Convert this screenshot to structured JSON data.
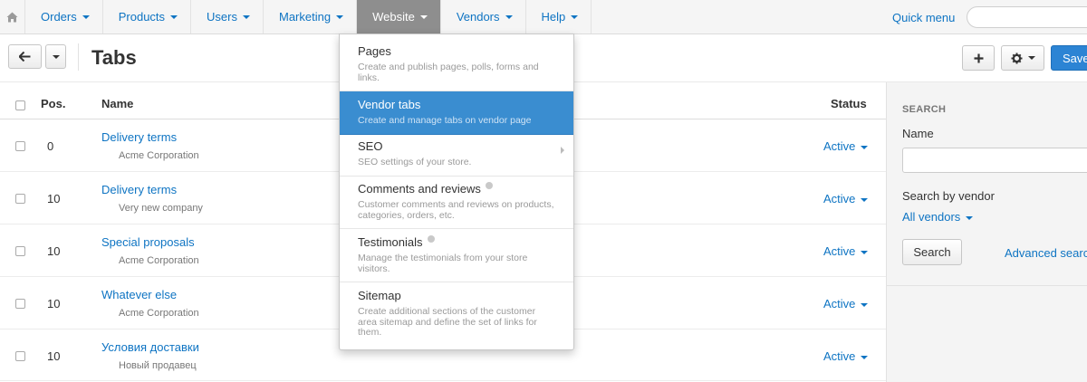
{
  "nav": {
    "home_icon": "home-icon",
    "items": [
      {
        "label": "Orders"
      },
      {
        "label": "Products"
      },
      {
        "label": "Users"
      },
      {
        "label": "Marketing"
      },
      {
        "label": "Website"
      },
      {
        "label": "Vendors"
      },
      {
        "label": "Help"
      }
    ],
    "active": "Website",
    "quick_menu": "Quick menu"
  },
  "toolbar": {
    "back_icon": "arrow-left-icon",
    "title": "Tabs",
    "add_icon": "plus-icon",
    "gear_icon": "gear-icon",
    "save_label": "Save"
  },
  "table": {
    "columns": {
      "pos": "Pos.",
      "name": "Name",
      "status": "Status"
    },
    "rows": [
      {
        "pos": "0",
        "name": "Delivery terms",
        "vendor": "Acme Corporation",
        "status": "Active"
      },
      {
        "pos": "10",
        "name": "Delivery terms",
        "vendor": "Very new company",
        "status": "Active"
      },
      {
        "pos": "10",
        "name": "Special proposals",
        "vendor": "Acme Corporation",
        "status": "Active"
      },
      {
        "pos": "10",
        "name": "Whatever else",
        "vendor": "Acme Corporation",
        "status": "Active"
      },
      {
        "pos": "10",
        "name": "Условия доставки",
        "vendor": "Новый продавец",
        "status": "Active"
      }
    ]
  },
  "sidebar": {
    "title": "SEARCH",
    "name_label": "Name",
    "vendor_label": "Search by vendor",
    "vendor_value": "All vendors",
    "search_button": "Search",
    "advanced_link": "Advanced search"
  },
  "dropdown": {
    "items": [
      {
        "title": "Pages",
        "desc": "Create and publish pages, polls, forms and links."
      },
      {
        "title": "Vendor tabs",
        "desc": "Create and manage tabs on vendor page"
      },
      {
        "title": "SEO",
        "desc": "SEO settings of your store."
      },
      {
        "title": "Comments and reviews",
        "desc": "Customer comments and reviews on products, categories, orders, etc."
      },
      {
        "title": "Testimonials",
        "desc": "Manage the testimonials from your store visitors."
      },
      {
        "title": "Sitemap",
        "desc": "Create additional sections of the customer area sitemap and define the set of links for them."
      }
    ],
    "active_index": 1
  },
  "colors": {
    "accent": "#0e74c3",
    "active_menu": "#3a8dd0",
    "save_button": "#2c84d4",
    "nav_active": "#8e8e8e"
  }
}
